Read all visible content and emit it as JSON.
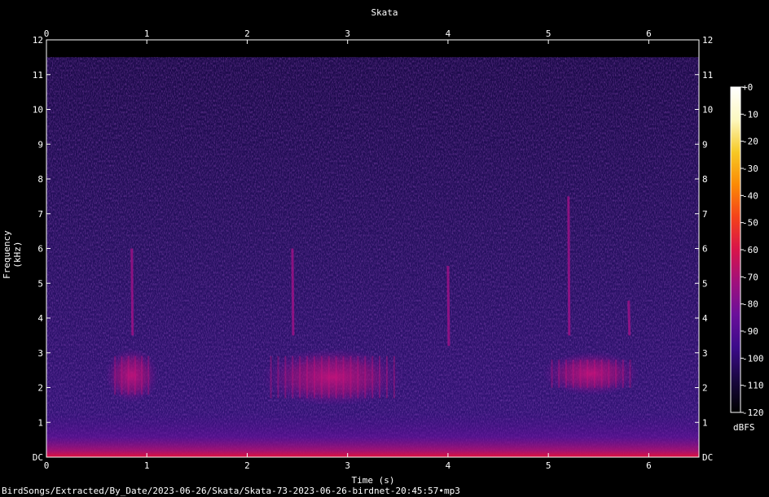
{
  "title": "Skata",
  "footer_path": "BirdSongs/Extracted/By_Date/2023-06-26/Skata/Skata-73-2023-06-26-birdnet-20:45:57•mp3",
  "colorbar_unit": "dBFS",
  "chart_data": {
    "type": "heatmap",
    "title": "Skata",
    "xlabel": "Time (s)",
    "ylabel": "Frequency (kHz)",
    "xlim": [
      0,
      6.5
    ],
    "ylim": [
      0,
      12
    ],
    "x_ticks": [
      "0",
      "1",
      "2",
      "3",
      "4",
      "5",
      "6"
    ],
    "y_ticks": [
      "DC",
      "1",
      "2",
      "3",
      "4",
      "5",
      "6",
      "7",
      "8",
      "9",
      "10",
      "11",
      "12"
    ],
    "colorbar": {
      "label": "dBFS",
      "range": [
        -120,
        0
      ],
      "ticks": [
        "+0",
        "-10",
        "-20",
        "-30",
        "-40",
        "-50",
        "-60",
        "-70",
        "-80",
        "-90",
        "-100",
        "-110",
        "-120"
      ],
      "colormap": [
        "#000000",
        "#1a0840",
        "#3c0b8a",
        "#6a0f9a",
        "#a0107c",
        "#d8144a",
        "#f4421a",
        "#fb8a05",
        "#f6c925",
        "#fcf8c0",
        "#ffffff"
      ]
    },
    "noise_floor_khz": 11.5,
    "calls": [
      {
        "t_start": 0.65,
        "t_end": 1.05,
        "f_low": 1.7,
        "f_high": 3.0
      },
      {
        "t_start": 2.2,
        "t_end": 3.5,
        "f_low": 1.6,
        "f_high": 3.0
      },
      {
        "t_start": 5.0,
        "t_end": 5.85,
        "f_low": 1.9,
        "f_high": 2.9
      }
    ],
    "sweeps": [
      {
        "t": 0.85,
        "f_low": 3.5,
        "f_high": 6.0
      },
      {
        "t": 2.45,
        "f_low": 3.5,
        "f_high": 6.0
      },
      {
        "t": 4.0,
        "f_low": 3.2,
        "f_high": 5.5
      },
      {
        "t": 5.2,
        "f_low": 3.5,
        "f_high": 7.5
      },
      {
        "t": 5.8,
        "f_low": 3.5,
        "f_high": 4.5
      }
    ]
  }
}
